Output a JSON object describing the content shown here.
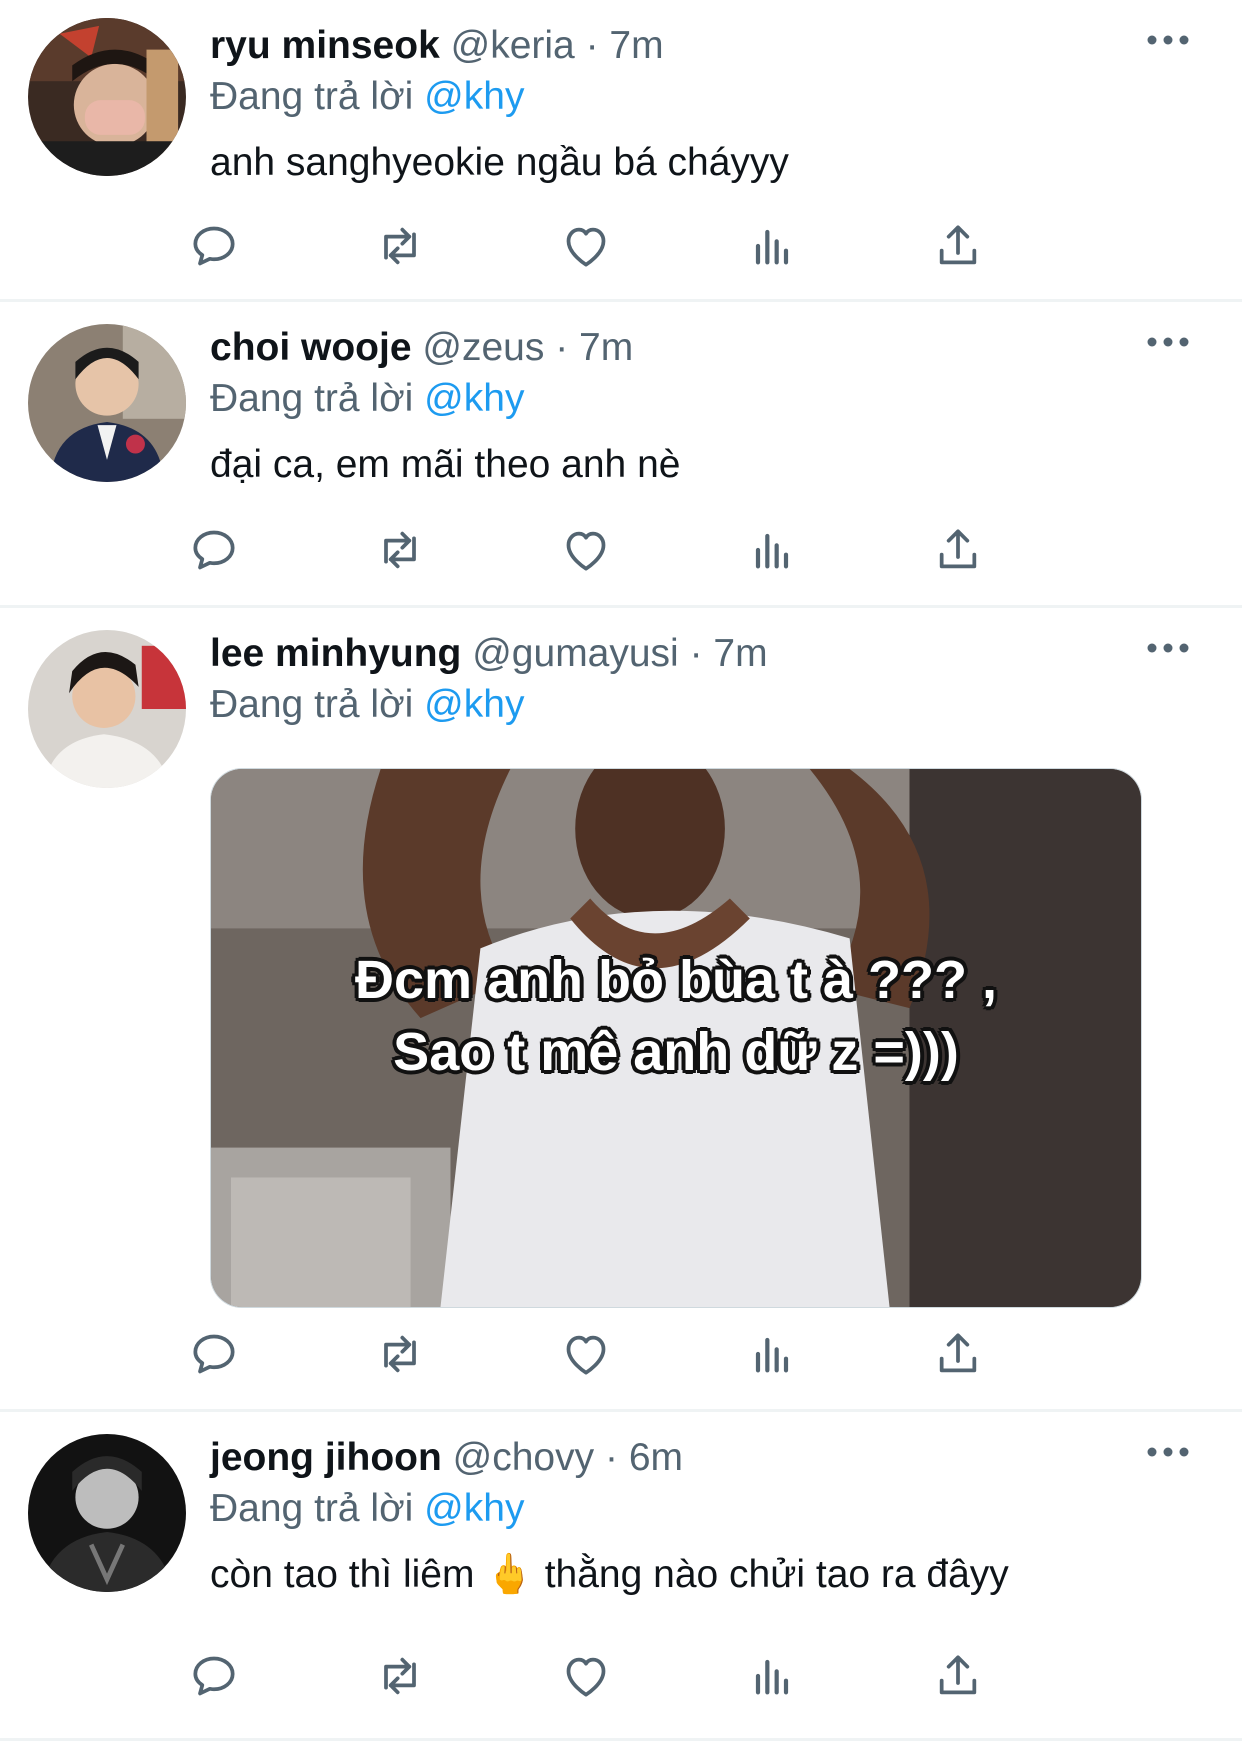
{
  "reply_prefix": "Đang trả lời",
  "tweets": [
    {
      "name": "ryu minseok",
      "handle": "@keria",
      "time": "7m",
      "reply_to": "@khy",
      "text": "anh sanghyeokie ngầu bá cháyyy"
    },
    {
      "name": "choi wooje",
      "handle": "@zeus",
      "time": "7m",
      "reply_to": "@khy",
      "text": "đại ca, em mãi theo anh nè"
    },
    {
      "name": "lee minhyung",
      "handle": "@gumayusi",
      "time": "7m",
      "reply_to": "@khy",
      "media": {
        "caption_line1": "Đcm anh bỏ bùa t à ??? ,",
        "caption_line2": "Sao t mê anh dữ z =)))"
      }
    },
    {
      "name": "jeong jihoon",
      "handle": "@chovy",
      "time": "6m",
      "reply_to": "@khy",
      "text_before": "còn tao thì liêm",
      "emoji": "🖕",
      "text_after": "thằng nào chửi tao ra đâyy"
    }
  ],
  "separator": "·",
  "colors": {
    "accent": "#1d9bf0",
    "secondary": "#536471",
    "divider": "#eff3f4"
  },
  "icons": [
    "reply-icon",
    "retweet-icon",
    "like-icon",
    "views-icon",
    "share-icon",
    "more-icon"
  ]
}
